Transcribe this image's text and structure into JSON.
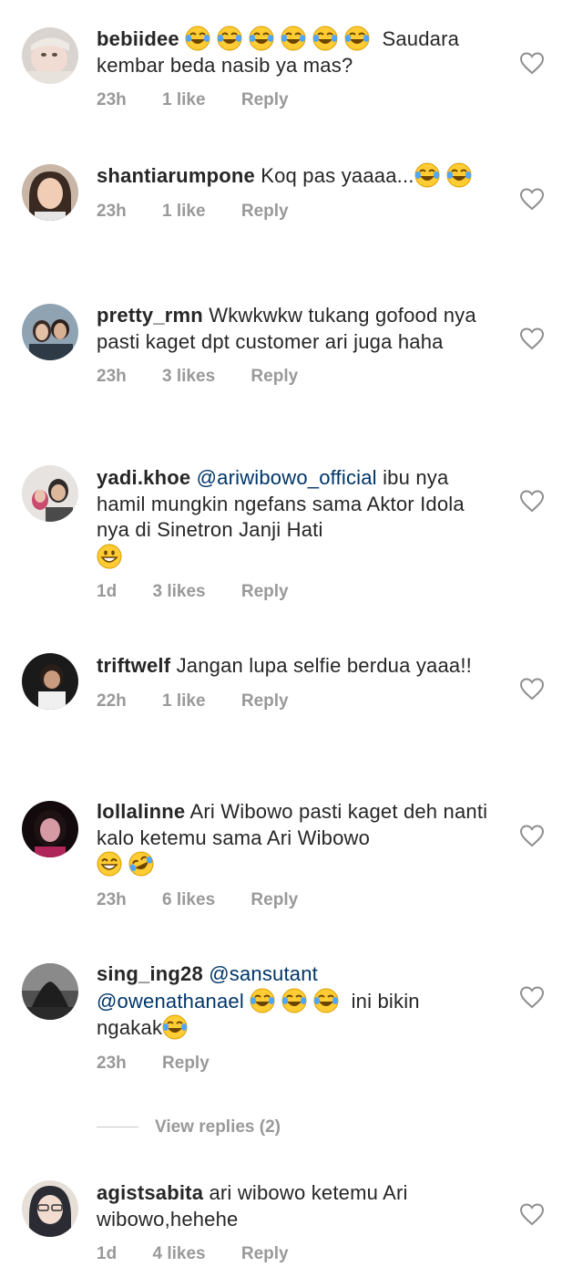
{
  "comments": [
    {
      "username": "bebiidee",
      "text_before": "",
      "mention": "",
      "emojis_a": [
        "tears-of-joy",
        "tears-of-joy",
        "tears-of-joy",
        "tears-of-joy",
        "tears-of-joy",
        "tears-of-joy"
      ],
      "text_after": "Saudara kembar beda nasib ya mas?",
      "time": "23h",
      "likes": "1 like",
      "reply": "Reply"
    },
    {
      "username": "shantiarumpone",
      "text_before": "Koq pas yaaaa...",
      "emojis_a": [
        "tears-of-joy",
        "tears-of-joy"
      ],
      "time": "23h",
      "likes": "1 like",
      "reply": "Reply"
    },
    {
      "username": "pretty_rmn",
      "text_before": "Wkwkwkw tukang gofood nya pasti kaget dpt customer ari juga haha",
      "time": "23h",
      "likes": "3 likes",
      "reply": "Reply"
    },
    {
      "username": "yadi.khoe",
      "mention": "@ariwibowo_official",
      "text_before": "ibu nya hamil mungkin ngefans sama Aktor Idola nya di Sinetron Janji Hati",
      "emojis_a": [
        "grinning"
      ],
      "time": "1d",
      "likes": "3 likes",
      "reply": "Reply"
    },
    {
      "username": "triftwelf",
      "text_before": "Jangan lupa selfie berdua yaaa!!",
      "time": "22h",
      "likes": "1 like",
      "reply": "Reply"
    },
    {
      "username": "lollalinne",
      "text_before": "Ari Wibowo pasti kaget deh nanti kalo ketemu sama Ari Wibowo",
      "emojis_a": [
        "grin",
        "rofl"
      ],
      "time": "23h",
      "likes": "6 likes",
      "reply": "Reply"
    },
    {
      "username": "sing_ing28",
      "mention": "@sansutant",
      "mention2": "@owenathanael",
      "emojis_a": [
        "tears-of-joy",
        "tears-of-joy",
        "tears-of-joy"
      ],
      "text_mid": "ini bikin ngakak",
      "emojis_b": [
        "tears-of-joy"
      ],
      "time": "23h",
      "likes": "",
      "reply": "Reply",
      "view_replies": "View replies (2)"
    },
    {
      "username": "agistsabita",
      "text_before": "ari wibowo ketemu Ari wibowo,hehehe",
      "time": "1d",
      "likes": "4 likes",
      "reply": "Reply"
    }
  ],
  "colors": {
    "text": "#262626",
    "meta": "#999999",
    "mention": "#003569",
    "heart_outline": "#8e8e8e"
  },
  "icons": {
    "like": "heart-outline-icon"
  }
}
